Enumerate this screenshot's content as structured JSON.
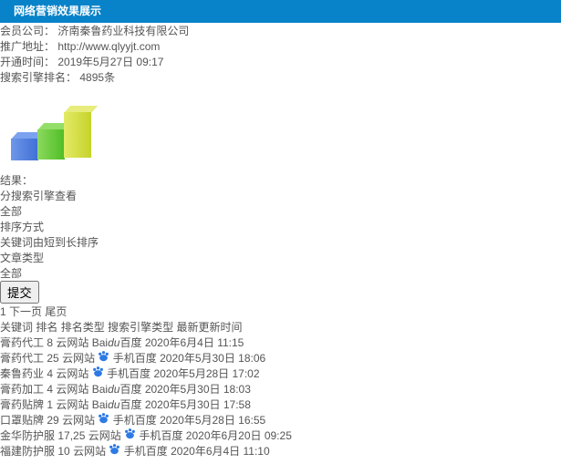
{
  "header": {
    "title": "网络营销效果展示",
    "bg": "#0882c8"
  },
  "info": {
    "rows": [
      {
        "label": "会员公司：",
        "value": "济南秦鲁药业科技有限公司"
      },
      {
        "label": "推广地址：",
        "value": "http://www.qlyyjt.com"
      },
      {
        "label": "开通时间：",
        "value": "2019年5月27日 09:17"
      },
      {
        "label": "搜索引擎排名：",
        "value": "4895",
        "suffix": "条"
      }
    ]
  },
  "filters": {
    "result_label": "结果：",
    "engine_label": "分搜索引擎查看",
    "engine_value": "全部",
    "sort_label": "排序方式",
    "sort_value": "关键词由短到长排序",
    "article_label": "文章类型",
    "article_value": "全部",
    "submit_label": "提交"
  },
  "pagination": {
    "current": "1",
    "next": "下一页",
    "last": "尾页"
  },
  "table": {
    "headers": [
      "关键词",
      "排名",
      "排名类型",
      "搜索引擎类型",
      "最新更新时间"
    ],
    "rows": [
      {
        "keyword": "膏药代工",
        "rank": "8",
        "rank_type": "云网站",
        "engine": "baidu",
        "time": "2020年6月4日 11:15"
      },
      {
        "keyword": "膏药代工",
        "rank": "25",
        "rank_type": "云网站",
        "engine": "mobile",
        "time": "2020年5月30日 18:06"
      },
      {
        "keyword": "秦鲁药业",
        "rank": "4",
        "rank_type": "云网站",
        "engine": "mobile",
        "time": "2020年5月28日 17:02"
      },
      {
        "keyword": "膏药加工",
        "rank": "4",
        "rank_type": "云网站",
        "engine": "baidu",
        "time": "2020年5月30日 18:03"
      },
      {
        "keyword": "膏药贴牌",
        "rank": "1",
        "rank_type": "云网站",
        "engine": "baidu",
        "time": "2020年5月30日 17:58"
      },
      {
        "keyword": "口罩贴牌",
        "rank": "29",
        "rank_type": "云网站",
        "engine": "mobile",
        "time": "2020年5月28日 16:55"
      },
      {
        "keyword": "金华防护服",
        "rank": "17,25",
        "rank_type": "云网站",
        "engine": "mobile",
        "time": "2020年6月20日 09:25"
      },
      {
        "keyword": "福建防护服",
        "rank": "10",
        "rank_type": "云网站",
        "engine": "mobile",
        "time": "2020年6月4日 11:10"
      }
    ]
  },
  "engine_labels": {
    "baidu_bai": "Bai",
    "baidu_du": "du",
    "baidu_cn": "百度",
    "mobile": "手机百度"
  },
  "colors": {
    "header_bg": "#0882c8",
    "link_blue": "#3f90d8",
    "rank_link_blue": "#4a9cd9",
    "count_red": "#f4544c",
    "baidu_red": "#e00601",
    "baidu_blue": "#2d36d8",
    "mobile_blue": "#3a87e0",
    "page_active_blue": "#2d7cbd",
    "filter_bg": "#f5f5f5"
  }
}
